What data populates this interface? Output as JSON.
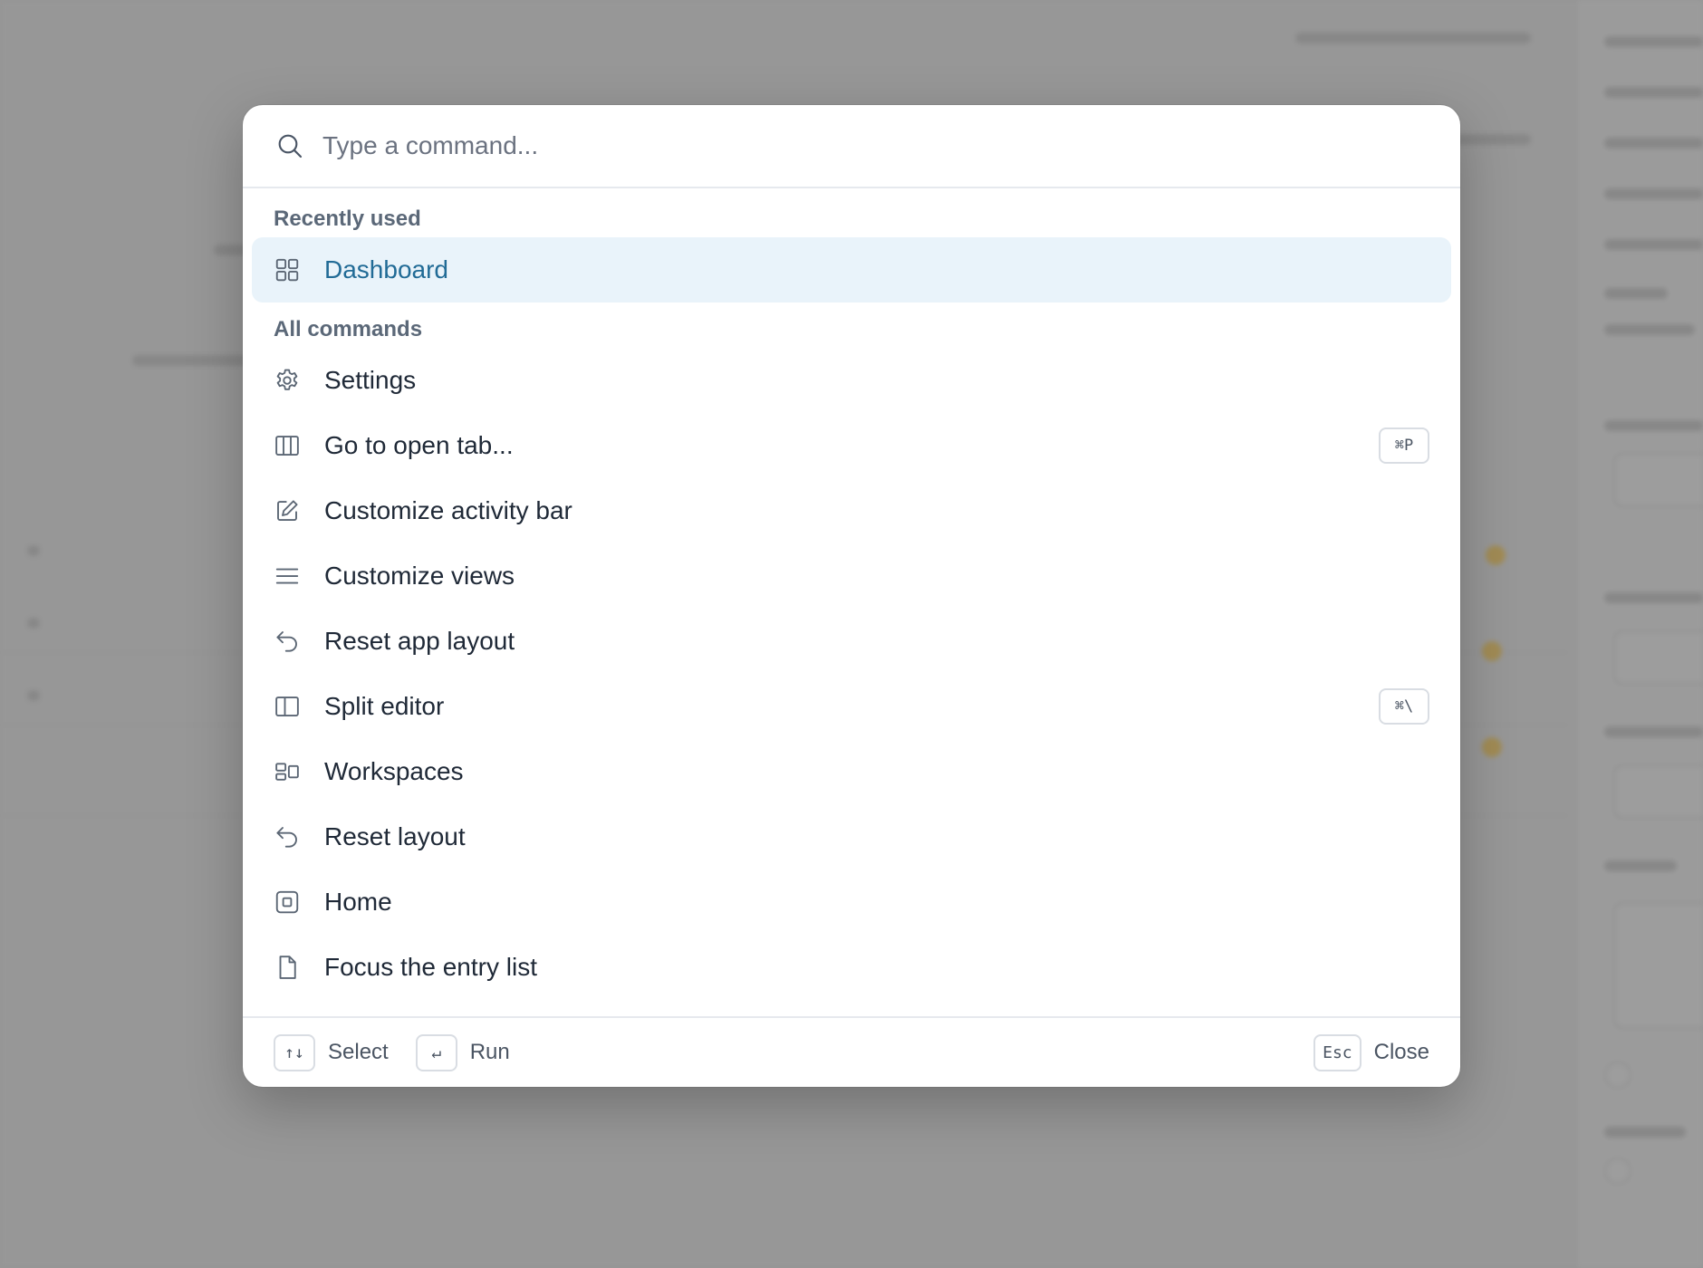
{
  "search": {
    "placeholder": "Type a command..."
  },
  "sections": {
    "recent_label": "Recently used",
    "all_label": "All commands"
  },
  "recent_items": [
    {
      "label": "Dashboard",
      "icon": "dashboard-grid-icon",
      "selected": true
    }
  ],
  "commands": [
    {
      "label": "Settings",
      "icon": "gear-icon",
      "shortcut": ""
    },
    {
      "label": "Go to open tab...",
      "icon": "columns-icon",
      "shortcut": "⌘P"
    },
    {
      "label": "Customize activity bar",
      "icon": "pencil-icon",
      "shortcut": ""
    },
    {
      "label": "Customize views",
      "icon": "menu-lines-icon",
      "shortcut": ""
    },
    {
      "label": "Reset app layout",
      "icon": "undo-arrow-icon",
      "shortcut": ""
    },
    {
      "label": "Split editor",
      "icon": "split-panel-icon",
      "shortcut": "⌘\\"
    },
    {
      "label": "Workspaces",
      "icon": "workspaces-icon",
      "shortcut": ""
    },
    {
      "label": "Reset layout",
      "icon": "undo-arrow-icon",
      "shortcut": ""
    },
    {
      "label": "Home",
      "icon": "home-square-icon",
      "shortcut": ""
    },
    {
      "label": "Focus the entry list",
      "icon": "file-icon",
      "shortcut": ""
    }
  ],
  "footer": {
    "select_key": "↑↓",
    "select_label": "Select",
    "run_key": "↵",
    "run_label": "Run",
    "close_key": "Esc",
    "close_label": "Close"
  }
}
